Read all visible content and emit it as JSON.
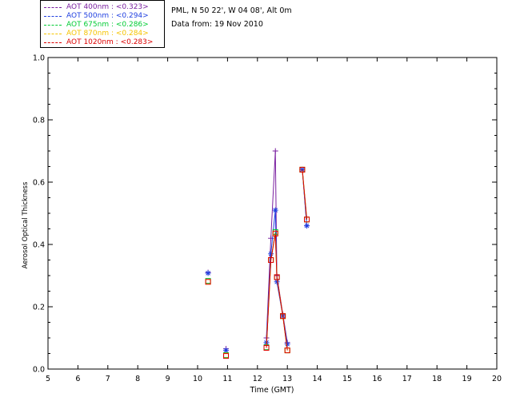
{
  "info": {
    "station": "PML, N 50 22', W 04 08', Alt 0m",
    "date": "Data from: 19 Nov 2010"
  },
  "legend": [
    {
      "label": "AOT  400nm : <0.323>",
      "color": "#7a1fa0"
    },
    {
      "label": "AOT  500nm : <0.294>",
      "color": "#1f3fe0"
    },
    {
      "label": "AOT  675nm : <0.286>",
      "color": "#00cc33"
    },
    {
      "label": "AOT  870nm : <0.284>",
      "color": "#f5c400"
    },
    {
      "label": "AOT 1020nm : <0.283>",
      "color": "#dd0000"
    }
  ],
  "chart_data": {
    "type": "scatter",
    "xlabel": "Time (GMT)",
    "ylabel": "Aerosol Optical Thickness",
    "xlim": [
      5,
      20
    ],
    "ylim": [
      0.0,
      1.0
    ],
    "xticks": [
      5,
      6,
      7,
      8,
      9,
      10,
      11,
      12,
      13,
      14,
      15,
      16,
      17,
      18,
      19,
      20
    ],
    "yticks": [
      0.0,
      0.2,
      0.4,
      0.6,
      0.8,
      1.0
    ],
    "ytick_labels": [
      "0.0",
      "0.2",
      "0.4",
      "0.6",
      "0.8",
      "1.0"
    ],
    "series": [
      {
        "name": "AOT  400nm",
        "color": "#7a1fa0",
        "marker": "plus",
        "x": [
          10.35,
          10.95,
          12.3,
          12.45,
          12.6,
          12.65,
          12.85,
          13.0,
          13.5,
          13.65
        ],
        "y": [
          0.31,
          0.065,
          0.1,
          0.42,
          0.7,
          0.3,
          0.175,
          0.085,
          0.64,
          0.46
        ],
        "segments": [
          [
            2,
            3,
            4,
            5,
            6,
            7
          ],
          [
            8,
            9
          ]
        ]
      },
      {
        "name": "AOT  500nm",
        "color": "#1f3fe0",
        "marker": "star",
        "x": [
          10.35,
          10.95,
          12.3,
          12.45,
          12.6,
          12.65,
          12.85,
          13.0,
          13.5,
          13.65
        ],
        "y": [
          0.308,
          0.06,
          0.085,
          0.37,
          0.51,
          0.28,
          0.17,
          0.08,
          0.64,
          0.46
        ],
        "segments": [
          [
            2,
            3,
            4,
            5,
            6,
            7
          ],
          [
            8,
            9
          ]
        ]
      },
      {
        "name": "AOT  675nm",
        "color": "#00cc33",
        "marker": "square",
        "x": [
          10.35,
          10.95,
          12.3,
          12.45,
          12.6,
          12.65,
          12.85,
          13.0,
          13.5,
          13.65
        ],
        "y": [
          0.283,
          0.045,
          0.07,
          0.35,
          0.44,
          0.295,
          0.17,
          0.06,
          0.64,
          0.48
        ],
        "segments": [
          [
            2,
            3,
            4,
            5,
            6,
            7
          ],
          [
            8,
            9
          ]
        ]
      },
      {
        "name": "AOT  870nm",
        "color": "#f5c400",
        "marker": "square",
        "x": [
          10.35,
          10.95,
          12.3,
          12.45,
          12.6,
          12.65,
          12.85,
          13.0,
          13.5,
          13.65
        ],
        "y": [
          0.28,
          0.043,
          0.068,
          0.35,
          0.435,
          0.295,
          0.17,
          0.06,
          0.64,
          0.48
        ],
        "segments": [
          [
            2,
            3,
            4,
            5,
            6,
            7
          ],
          [
            8,
            9
          ]
        ]
      },
      {
        "name": "AOT 1020nm",
        "color": "#dd0000",
        "marker": "square",
        "x": [
          10.35,
          10.95,
          12.3,
          12.45,
          12.6,
          12.65,
          12.85,
          13.0,
          13.5,
          13.65
        ],
        "y": [
          0.28,
          0.042,
          0.068,
          0.35,
          0.435,
          0.295,
          0.17,
          0.06,
          0.64,
          0.48
        ],
        "segments": [
          [
            2,
            3,
            4,
            5,
            6,
            7
          ],
          [
            8,
            9
          ]
        ]
      }
    ]
  }
}
